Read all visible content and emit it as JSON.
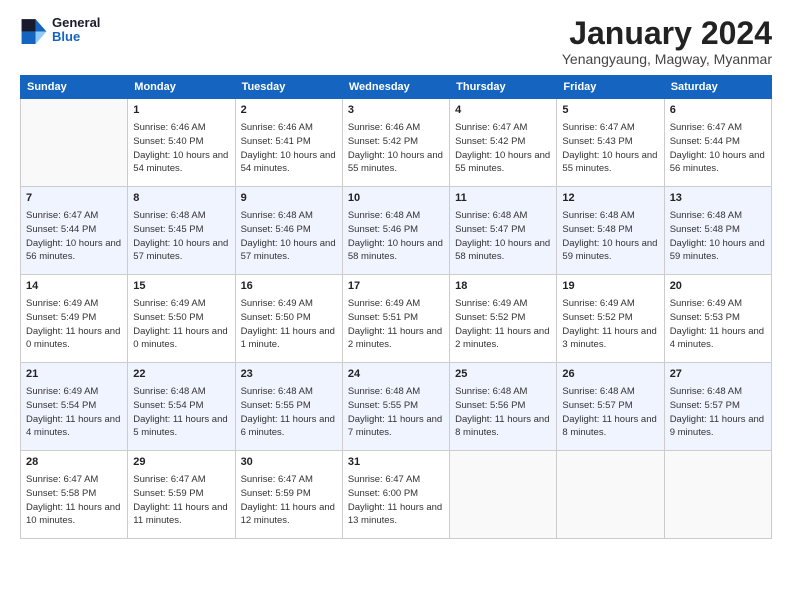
{
  "header": {
    "logo_general": "General",
    "logo_blue": "Blue",
    "month_title": "January 2024",
    "subtitle": "Yenangyaung, Magway, Myanmar"
  },
  "days_of_week": [
    "Sunday",
    "Monday",
    "Tuesday",
    "Wednesday",
    "Thursday",
    "Friday",
    "Saturday"
  ],
  "weeks": [
    [
      {
        "day": "",
        "sunrise": "",
        "sunset": "",
        "daylight": ""
      },
      {
        "day": "1",
        "sunrise": "Sunrise: 6:46 AM",
        "sunset": "Sunset: 5:40 PM",
        "daylight": "Daylight: 10 hours and 54 minutes."
      },
      {
        "day": "2",
        "sunrise": "Sunrise: 6:46 AM",
        "sunset": "Sunset: 5:41 PM",
        "daylight": "Daylight: 10 hours and 54 minutes."
      },
      {
        "day": "3",
        "sunrise": "Sunrise: 6:46 AM",
        "sunset": "Sunset: 5:42 PM",
        "daylight": "Daylight: 10 hours and 55 minutes."
      },
      {
        "day": "4",
        "sunrise": "Sunrise: 6:47 AM",
        "sunset": "Sunset: 5:42 PM",
        "daylight": "Daylight: 10 hours and 55 minutes."
      },
      {
        "day": "5",
        "sunrise": "Sunrise: 6:47 AM",
        "sunset": "Sunset: 5:43 PM",
        "daylight": "Daylight: 10 hours and 55 minutes."
      },
      {
        "day": "6",
        "sunrise": "Sunrise: 6:47 AM",
        "sunset": "Sunset: 5:44 PM",
        "daylight": "Daylight: 10 hours and 56 minutes."
      }
    ],
    [
      {
        "day": "7",
        "sunrise": "Sunrise: 6:47 AM",
        "sunset": "Sunset: 5:44 PM",
        "daylight": "Daylight: 10 hours and 56 minutes."
      },
      {
        "day": "8",
        "sunrise": "Sunrise: 6:48 AM",
        "sunset": "Sunset: 5:45 PM",
        "daylight": "Daylight: 10 hours and 57 minutes."
      },
      {
        "day": "9",
        "sunrise": "Sunrise: 6:48 AM",
        "sunset": "Sunset: 5:46 PM",
        "daylight": "Daylight: 10 hours and 57 minutes."
      },
      {
        "day": "10",
        "sunrise": "Sunrise: 6:48 AM",
        "sunset": "Sunset: 5:46 PM",
        "daylight": "Daylight: 10 hours and 58 minutes."
      },
      {
        "day": "11",
        "sunrise": "Sunrise: 6:48 AM",
        "sunset": "Sunset: 5:47 PM",
        "daylight": "Daylight: 10 hours and 58 minutes."
      },
      {
        "day": "12",
        "sunrise": "Sunrise: 6:48 AM",
        "sunset": "Sunset: 5:48 PM",
        "daylight": "Daylight: 10 hours and 59 minutes."
      },
      {
        "day": "13",
        "sunrise": "Sunrise: 6:48 AM",
        "sunset": "Sunset: 5:48 PM",
        "daylight": "Daylight: 10 hours and 59 minutes."
      }
    ],
    [
      {
        "day": "14",
        "sunrise": "Sunrise: 6:49 AM",
        "sunset": "Sunset: 5:49 PM",
        "daylight": "Daylight: 11 hours and 0 minutes."
      },
      {
        "day": "15",
        "sunrise": "Sunrise: 6:49 AM",
        "sunset": "Sunset: 5:50 PM",
        "daylight": "Daylight: 11 hours and 0 minutes."
      },
      {
        "day": "16",
        "sunrise": "Sunrise: 6:49 AM",
        "sunset": "Sunset: 5:50 PM",
        "daylight": "Daylight: 11 hours and 1 minute."
      },
      {
        "day": "17",
        "sunrise": "Sunrise: 6:49 AM",
        "sunset": "Sunset: 5:51 PM",
        "daylight": "Daylight: 11 hours and 2 minutes."
      },
      {
        "day": "18",
        "sunrise": "Sunrise: 6:49 AM",
        "sunset": "Sunset: 5:52 PM",
        "daylight": "Daylight: 11 hours and 2 minutes."
      },
      {
        "day": "19",
        "sunrise": "Sunrise: 6:49 AM",
        "sunset": "Sunset: 5:52 PM",
        "daylight": "Daylight: 11 hours and 3 minutes."
      },
      {
        "day": "20",
        "sunrise": "Sunrise: 6:49 AM",
        "sunset": "Sunset: 5:53 PM",
        "daylight": "Daylight: 11 hours and 4 minutes."
      }
    ],
    [
      {
        "day": "21",
        "sunrise": "Sunrise: 6:49 AM",
        "sunset": "Sunset: 5:54 PM",
        "daylight": "Daylight: 11 hours and 4 minutes."
      },
      {
        "day": "22",
        "sunrise": "Sunrise: 6:48 AM",
        "sunset": "Sunset: 5:54 PM",
        "daylight": "Daylight: 11 hours and 5 minutes."
      },
      {
        "day": "23",
        "sunrise": "Sunrise: 6:48 AM",
        "sunset": "Sunset: 5:55 PM",
        "daylight": "Daylight: 11 hours and 6 minutes."
      },
      {
        "day": "24",
        "sunrise": "Sunrise: 6:48 AM",
        "sunset": "Sunset: 5:55 PM",
        "daylight": "Daylight: 11 hours and 7 minutes."
      },
      {
        "day": "25",
        "sunrise": "Sunrise: 6:48 AM",
        "sunset": "Sunset: 5:56 PM",
        "daylight": "Daylight: 11 hours and 8 minutes."
      },
      {
        "day": "26",
        "sunrise": "Sunrise: 6:48 AM",
        "sunset": "Sunset: 5:57 PM",
        "daylight": "Daylight: 11 hours and 8 minutes."
      },
      {
        "day": "27",
        "sunrise": "Sunrise: 6:48 AM",
        "sunset": "Sunset: 5:57 PM",
        "daylight": "Daylight: 11 hours and 9 minutes."
      }
    ],
    [
      {
        "day": "28",
        "sunrise": "Sunrise: 6:47 AM",
        "sunset": "Sunset: 5:58 PM",
        "daylight": "Daylight: 11 hours and 10 minutes."
      },
      {
        "day": "29",
        "sunrise": "Sunrise: 6:47 AM",
        "sunset": "Sunset: 5:59 PM",
        "daylight": "Daylight: 11 hours and 11 minutes."
      },
      {
        "day": "30",
        "sunrise": "Sunrise: 6:47 AM",
        "sunset": "Sunset: 5:59 PM",
        "daylight": "Daylight: 11 hours and 12 minutes."
      },
      {
        "day": "31",
        "sunrise": "Sunrise: 6:47 AM",
        "sunset": "Sunset: 6:00 PM",
        "daylight": "Daylight: 11 hours and 13 minutes."
      },
      {
        "day": "",
        "sunrise": "",
        "sunset": "",
        "daylight": ""
      },
      {
        "day": "",
        "sunrise": "",
        "sunset": "",
        "daylight": ""
      },
      {
        "day": "",
        "sunrise": "",
        "sunset": "",
        "daylight": ""
      }
    ]
  ]
}
